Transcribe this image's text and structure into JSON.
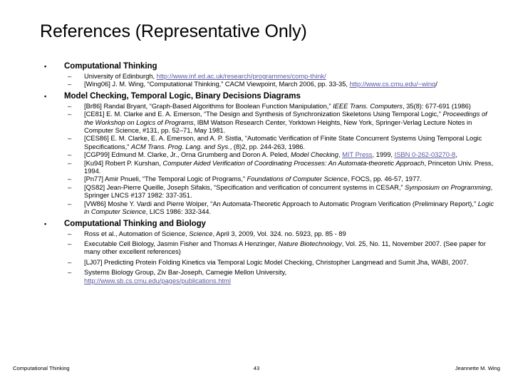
{
  "slide": {
    "title": "References (Representative Only)",
    "bullet_marker": "•",
    "dash_marker": "–"
  },
  "sections": [
    {
      "heading": "Computational Thinking",
      "entries": [
        {
          "id": "edinburgh",
          "pre": "University of Edinburgh, ",
          "link": "http://www.inf.ed.ac.uk/research/programmes/comp-think/",
          "post": ""
        },
        {
          "id": "wing06",
          "pre": "[Wing06] J. M. Wing, “Computational Thinking,” CACM Viewpoint, March 2006, pp. 33-35, ",
          "link": "http://www.cs.cmu.edu/~wing",
          "post": "/"
        }
      ]
    },
    {
      "heading": "Model Checking, Temporal Logic, Binary Decisions Diagrams",
      "entries": [
        {
          "id": "br86",
          "t1": "[Br86] Randal Bryant, “Graph-Based Algorithms for Boolean Function Manipulation,” ",
          "i1": "IEEE Trans. Computers",
          "t2": ", 35(8): 677-691 (1986)"
        },
        {
          "id": "ce81",
          "t1": "[CE81] E. M. Clarke and E. A. Emerson, “The Design and Synthesis of Synchronization Skeletons Using Temporal Logic,” ",
          "i1": "Proceedings of the Workshop on Logics of Programs",
          "t2": ", IBM Watson Research Center, Yorktown Heights, New York, Springer-Verlag Lecture Notes in Computer Science, #131, pp. 52–71, May 1981."
        },
        {
          "id": "ces86",
          "t1": "[CES86] E. M. Clarke, E. A. Emerson, and A. P. Sistla, “Automatic Verification of Finite State Concurrent Systems Using Temporal Logic Specifications,” ",
          "i1": "ACM Trans. Prog. Lang. and Sys.",
          "t2": ", (8)2, pp. 244-263, 1986."
        },
        {
          "id": "cgp99",
          "t1": "[CGP99] Edmund M. Clarke, Jr., Orna Grumberg and Doron A. Peled, ",
          "i1": "Model Checking",
          "t2": ", ",
          "link1": "MIT Press",
          "t3": ", 1999, ",
          "link2": "ISBN 0-262-03270-8",
          "t4": ","
        },
        {
          "id": "ku94",
          "t1": "[Ku94] Robert P. Kurshan, ",
          "i1": "Computer Aided Verification of Coordinating Processes: An Automata-theoretic Approach",
          "t2": ", Princeton Univ. Press, 1994."
        },
        {
          "id": "pn77",
          "t1": "[Pn77] Amir Pnueli, “The Temporal Logic of Programs,” ",
          "i1": "Foundations of Computer Science",
          "t2": ", FOCS, pp. 46-57, 1977."
        },
        {
          "id": "qs82",
          "t1": "[QS82] Jean-Pierre Queille, Joseph Sifakis, “Specification and verification of concurrent systems in CESAR,” ",
          "i1": "Symposium on Programming",
          "t2": ", Springer LNCS #137 1982: 337-351."
        },
        {
          "id": "vw86",
          "t1": "[VW86] Moshe Y. Vardi and Pierre Wolper, “An Automata-Theoretic Approach to Automatic Program Verification (Preliminary Report),” ",
          "i1": "Logic in Computer Science",
          "t2": ", LICS 1986: 332-344."
        }
      ]
    },
    {
      "heading": "Computational Thinking and Biology",
      "entries": [
        {
          "id": "ross09",
          "t1": "Ross et al., Automation of Science, ",
          "i1": "Science",
          "t2": ", April 3, 2009, Vol. 324. no. 5923, pp. 85 - 89"
        },
        {
          "id": "fisher07",
          "t1": "Executable Cell Biology, Jasmin Fisher and Thomas A Henzinger, ",
          "i1": "Nature Biotechnology",
          "t2": ", Vol. 25, No. 11, November 2007. (See paper for many other excellent references)"
        },
        {
          "id": "lj07",
          "t1": "[LJ07] Predicting Protein Folding Kinetics via Temporal Logic Model Checking, Christopher Langmead and Sumit Jha, WABI, 2007.",
          "i1": "",
          "t2": ""
        },
        {
          "id": "sysbio",
          "pre": "Systems Biology Group, Ziv Bar-Joseph, Carnegie Mellon University, ",
          "link": "http://www.sb.cs.cmu.edu/pages/publications.html",
          "post": ""
        }
      ]
    }
  ],
  "footer": {
    "left": "Computational Thinking",
    "page": "43",
    "right": "Jeannette M. Wing"
  },
  "colors": {
    "link": "#5a5aa5",
    "text": "#000000",
    "background": "#ffffff"
  }
}
